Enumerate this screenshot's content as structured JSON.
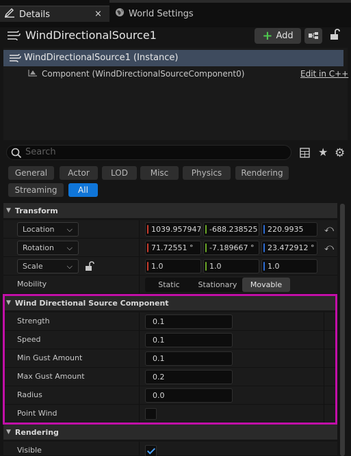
{
  "tabs": [
    {
      "label": "Details",
      "close": "×"
    },
    {
      "label": "World Settings"
    }
  ],
  "header": {
    "actor_name": "WindDirectionalSource1",
    "add_label": "Add"
  },
  "tree": {
    "instance_label": "WindDirectionalSource1 (Instance)",
    "component_label": "Component (WindDirectionalSourceComponent0)",
    "edit_link": "Edit in C++"
  },
  "search": {
    "placeholder": "Search"
  },
  "filters": [
    "General",
    "Actor",
    "LOD",
    "Misc",
    "Physics",
    "Rendering",
    "Streaming",
    "All"
  ],
  "active_filter": "All",
  "transform": {
    "title": "Transform",
    "location": {
      "label": "Location",
      "x": "1039.957947",
      "y": "-688.238525",
      "z": "220.9935"
    },
    "rotation": {
      "label": "Rotation",
      "x": "71.72551 °",
      "y": "-7.189667 °",
      "z": "23.472912 °"
    },
    "scale": {
      "label": "Scale",
      "x": "1.0",
      "y": "1.0",
      "z": "1.0"
    },
    "mobility": {
      "label": "Mobility",
      "options": [
        "Static",
        "Stationary",
        "Movable"
      ],
      "selected": "Movable"
    }
  },
  "wind": {
    "title": "Wind Directional Source Component",
    "strength": {
      "label": "Strength",
      "value": "0.1"
    },
    "speed": {
      "label": "Speed",
      "value": "0.1"
    },
    "min_gust": {
      "label": "Min Gust Amount",
      "value": "0.1"
    },
    "max_gust": {
      "label": "Max Gust Amount",
      "value": "0.2"
    },
    "radius": {
      "label": "Radius",
      "value": "0.0"
    },
    "point_wind": {
      "label": "Point Wind",
      "checked": false
    }
  },
  "rendering": {
    "title": "Rendering",
    "visible": {
      "label": "Visible",
      "checked": true
    }
  },
  "colors": {
    "highlight": "#c20fa8",
    "accent": "#0f75d8"
  }
}
